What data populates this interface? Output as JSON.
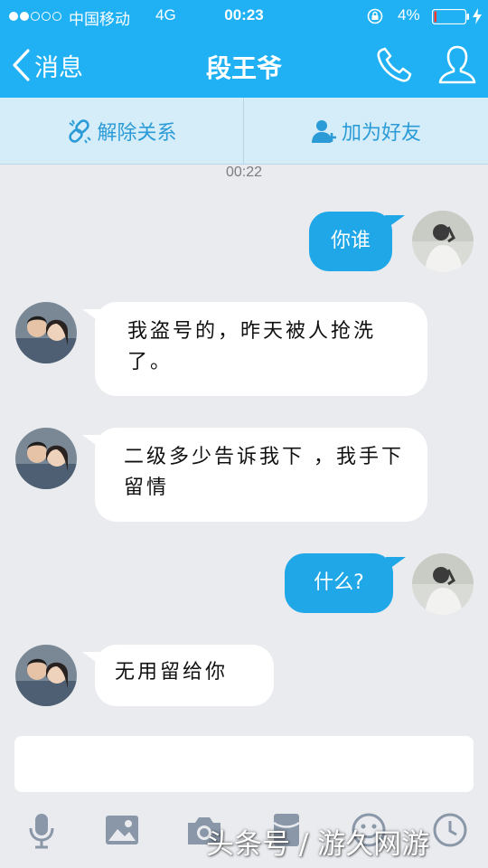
{
  "status_bar": {
    "carrier": "中国移动",
    "network": "4G",
    "time": "00:23",
    "battery_percent": "4%",
    "signal_filled_dots": 2,
    "signal_total_dots": 5
  },
  "nav": {
    "back_label": "消息",
    "title": "段王爷",
    "call_icon": "phone-icon",
    "profile_icon": "person-icon"
  },
  "relation_bar": {
    "unlink_label": "解除关系",
    "add_friend_label": "加为好友"
  },
  "chat": {
    "timestamp": "00:22",
    "messages": [
      {
        "side": "out",
        "text": "你谁"
      },
      {
        "side": "in",
        "text": "我盗号的，昨天被人抢洗了。"
      },
      {
        "side": "in",
        "text": "二级多少告诉我下 ，我手下留情"
      },
      {
        "side": "out",
        "text": "什么?"
      },
      {
        "side": "in",
        "text": "无用留给你"
      }
    ]
  },
  "input": {
    "placeholder": ""
  },
  "toolbar": {
    "icons": [
      "microphone-icon",
      "image-icon",
      "camera-icon",
      "red-packet-icon",
      "emoji-icon",
      "more-icon"
    ]
  },
  "watermark": "头条号 / 游久网游",
  "colors": {
    "accent": "#1fb1f3",
    "bubble_out": "#1fa7e8",
    "bubble_in": "#ffffff",
    "chat_background": "#e9ebef",
    "relation_bar": "#d4edf9"
  }
}
